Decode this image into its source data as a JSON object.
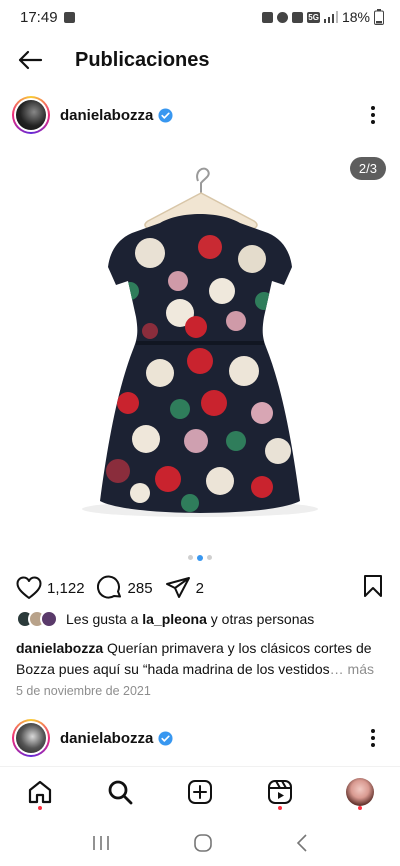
{
  "status_bar": {
    "time": "17:49",
    "battery": "18%",
    "network": "5G"
  },
  "header": {
    "title": "Publicaciones"
  },
  "post": {
    "username": "danielabozza",
    "slide_counter": "2/3",
    "slide_index": 2,
    "slide_total": 3,
    "likes_count": "1,122",
    "comments_count": "285",
    "shares_count": "2",
    "liked_by_prefix": "Les gusta a",
    "liked_by_user": "la_pleona",
    "liked_by_suffix": "y otras personas",
    "caption_user": "danielabozza",
    "caption_text": "Querían primavera y los clásicos cortes de Bozza pues aquí su “hada madrina de los  vestidos",
    "caption_more": "… más",
    "date": "5 de noviembre de 2021"
  },
  "next_post": {
    "username": "danielabozza"
  },
  "colors": {
    "accent": "#3897f0",
    "notification": "#ff3040",
    "muted": "#8e8e8e"
  },
  "icons": {
    "back": "arrow-left-icon",
    "verified": "verified-badge-icon",
    "more": "more-vertical-icon",
    "like": "heart-icon",
    "comment": "comment-icon",
    "share": "send-icon",
    "save": "bookmark-icon",
    "home": "home-icon",
    "search": "search-icon",
    "create": "add-post-icon",
    "reels": "reels-icon"
  }
}
